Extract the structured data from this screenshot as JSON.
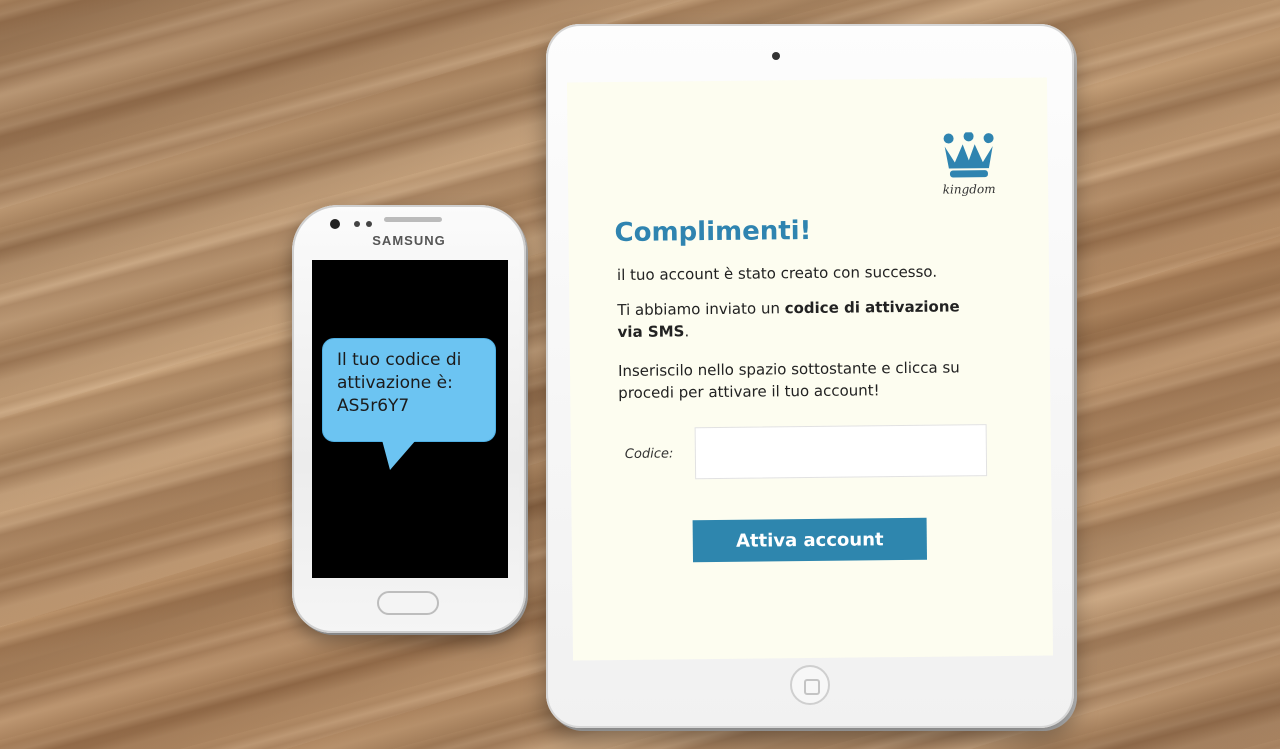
{
  "phone": {
    "brand": "SAMSUNG",
    "sms_lines": [
      "Il tuo codice di",
      "attivazione è:",
      "AS5r6Y7"
    ]
  },
  "tablet": {
    "logo_text": "kingdom",
    "title": "Complimenti!",
    "para1": "il tuo account è stato creato con successo.",
    "para2_prefix": "Ti abbiamo inviato un ",
    "para2_bold": "codice di attivazione via SMS",
    "para2_suffix": ".",
    "para3": "Inseriscilo nello spazio sottostante e clicca su procedi per attivare il tuo account!",
    "code_label": "Codice:",
    "code_value": "",
    "submit_label": "Attiva account"
  },
  "colors": {
    "accent": "#2e86ae",
    "title": "#2f84b0",
    "sms_bubble": "#6cc4f2",
    "screen_bg": "#fdfdf0"
  },
  "icons": {
    "logo": "crown-icon"
  }
}
